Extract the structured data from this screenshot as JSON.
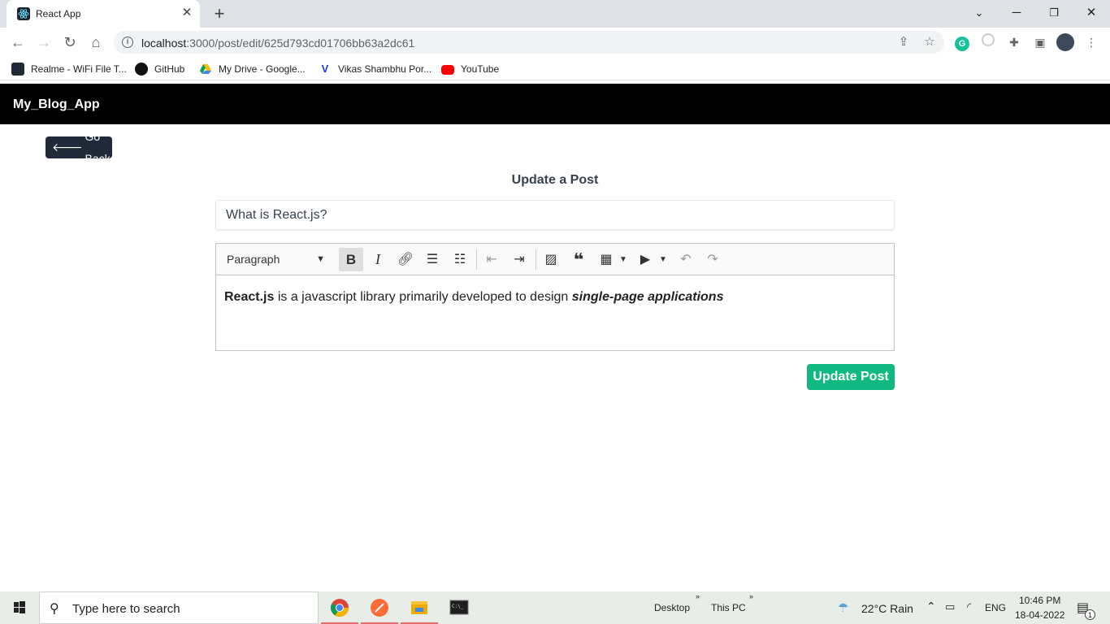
{
  "browser": {
    "tab_title": "React App",
    "url_host": "localhost",
    "url_rest": ":3000/post/edit/625d793cd01706bb63a2dc61",
    "bookmarks": [
      "Realme - WiFi File T...",
      "GitHub",
      "My Drive - Google...",
      "Vikas Shambhu Por...",
      "YouTube"
    ]
  },
  "app": {
    "brand": "My_Blog_App",
    "back_label": "Go Back",
    "page_title": "Update a Post",
    "title_value": "What is React.js?",
    "editor": {
      "block_format": "Paragraph",
      "content_bold": "React.js",
      "content_plain": " is a javascript library primarily developed to design ",
      "content_bold_italic": "single-page applications"
    },
    "submit_label": "Update Post"
  },
  "taskbar": {
    "search_placeholder": "Type here to search",
    "desktop_label": "Desktop",
    "thispc_label": "This PC",
    "weather": "22°C  Rain",
    "lang": "ENG",
    "time": "10:46 PM",
    "date": "18-04-2022",
    "notif_count": "1"
  },
  "colors": {
    "nav_bg": "#000000",
    "back_btn": "#1f2937",
    "submit_btn": "#10b981"
  }
}
